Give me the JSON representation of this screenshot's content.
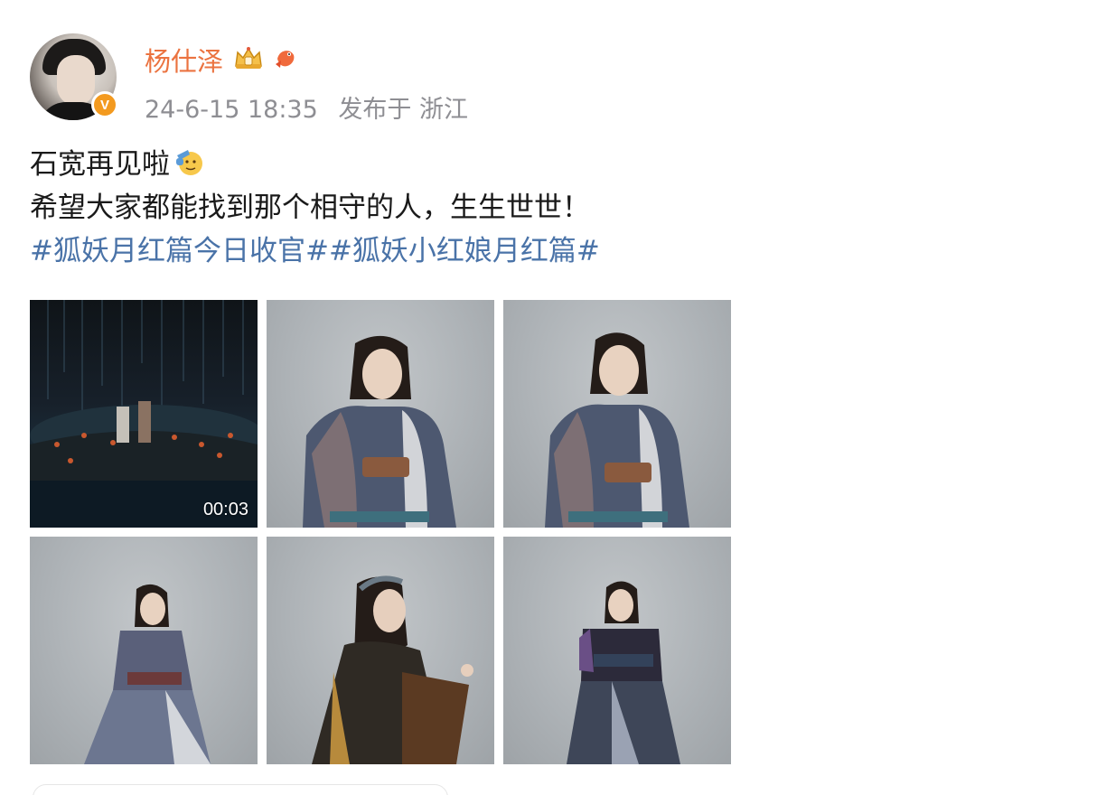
{
  "post": {
    "author": "杨仕泽",
    "verified_mark": "V",
    "timestamp": "24-6-15 18:35",
    "source": "发布于 浙江",
    "badges": [
      "crown-badge-icon",
      "fish-badge-icon"
    ],
    "text_line1": "石宽再见啦",
    "text_line2": "希望大家都能找到那个相守的人，生生世世！",
    "hashtag1": "#狐妖月红篇今日收官#",
    "hashtag2": "#狐妖小红娘月红篇#",
    "colors": {
      "author": "#eb7340",
      "hashtag": "#4a73a8",
      "meta": "#8e8e93",
      "verified": "#f39a1f"
    }
  },
  "media": {
    "video_duration": "00:03",
    "tiles": [
      "video-thumbnail",
      "photo-2",
      "photo-3",
      "photo-4",
      "photo-5",
      "photo-6"
    ]
  }
}
